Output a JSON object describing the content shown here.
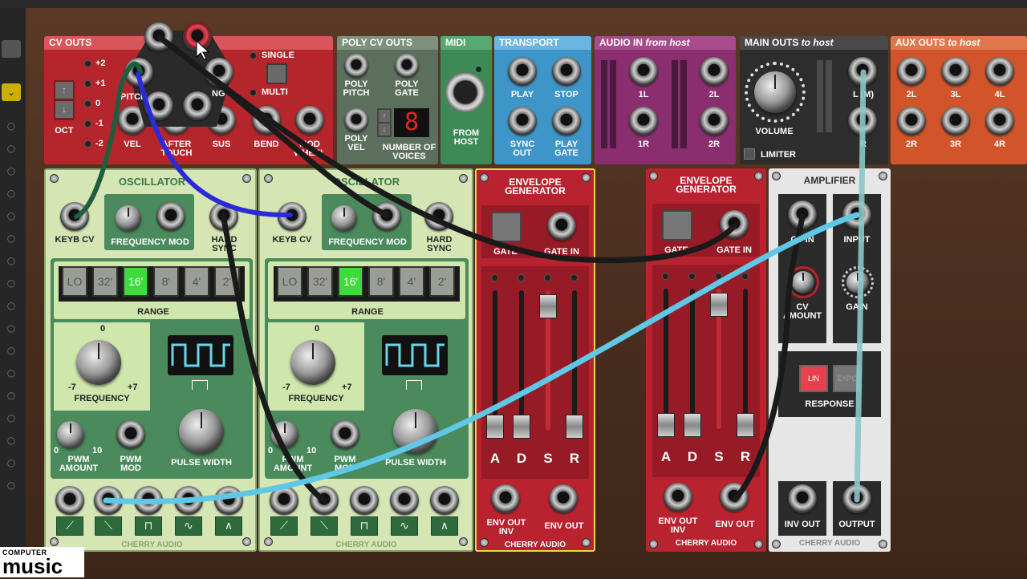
{
  "cv_outs": {
    "title": "CV OUTS",
    "octaves": [
      "+2",
      "+1",
      "0",
      "-1",
      "-2"
    ],
    "oct_label": "OCT",
    "mode_single": "SINGLE",
    "mode_multi": "MULTI",
    "jack_labels": [
      "PITCH",
      "VEL",
      "AFTER TOUCH",
      "SUS",
      "BEND",
      "MOD WHEEL",
      "NG"
    ]
  },
  "poly_cv_outs": {
    "title": "POLY CV OUTS",
    "poly_pitch": "POLY PITCH",
    "poly_gate": "POLY GATE",
    "poly_vel": "POLY VEL",
    "voices_label": "NUMBER OF VOICES",
    "voices_value": "8"
  },
  "midi": {
    "title": "MIDI",
    "from_host": "FROM HOST"
  },
  "transport": {
    "title": "TRANSPORT",
    "play": "PLAY",
    "stop": "STOP",
    "sync_out": "SYNC OUT",
    "play_gate": "PLAY GATE"
  },
  "audio_in": {
    "title": "AUDIO IN",
    "title_suffix": "from host",
    "l1": "1L",
    "r1": "1R",
    "l2": "2L",
    "r2": "2R"
  },
  "main_outs": {
    "title": "MAIN OUTS",
    "title_suffix": "to host",
    "volume": "VOLUME",
    "limiter": "LIMITER",
    "out_l": "L (M)",
    "out_r": "R"
  },
  "aux_outs": {
    "title": "AUX OUTS",
    "title_suffix": "to host",
    "labels": [
      "2L",
      "3L",
      "4L",
      "2R",
      "3R",
      "4R"
    ]
  },
  "oscillators": [
    {
      "title": "OSCILLATOR",
      "keyb_cv": "KEYB CV",
      "freq_mod": "FREQUENCY MOD",
      "hard_sync": "HARD SYNC",
      "range_options": [
        "LO",
        "32'",
        "16'",
        "8'",
        "4'",
        "2'"
      ],
      "range_selected": "16'",
      "range_label": "RANGE",
      "freq_zero": "0",
      "freq_min": "-7",
      "freq_max": "+7",
      "frequency_label": "FREQUENCY",
      "pwm_min": "0",
      "pwm_max": "10",
      "pwm_amount": "PWM AMOUNT",
      "pwm_mod": "PWM MOD",
      "pulse_width": "PULSE WIDTH",
      "brand": "CHERRY AUDIO"
    },
    {
      "title": "OSCILLATOR",
      "keyb_cv": "KEYB CV",
      "freq_mod": "FREQUENCY MOD",
      "hard_sync": "HARD SYNC",
      "range_options": [
        "LO",
        "32'",
        "16'",
        "8'",
        "4'",
        "2'"
      ],
      "range_selected": "16'",
      "range_label": "RANGE",
      "freq_zero": "0",
      "freq_min": "-7",
      "freq_max": "+7",
      "frequency_label": "FREQUENCY",
      "pwm_min": "0",
      "pwm_max": "10",
      "pwm_amount": "PWM AMOUNT",
      "pwm_mod": "PWM MOD",
      "pulse_width": "PULSE WIDTH",
      "brand": "CHERRY AUDIO"
    }
  ],
  "envelopes": [
    {
      "title": "ENVELOPE GENERATOR",
      "gate": "GATE",
      "gate_in": "GATE IN",
      "adsr": [
        "A",
        "D",
        "S",
        "R"
      ],
      "env_out_inv": "ENV OUT INV",
      "env_out": "ENV OUT",
      "brand": "CHERRY AUDIO"
    },
    {
      "title": "ENVELOPE GENERATOR",
      "gate": "GATE",
      "gate_in": "GATE IN",
      "adsr": [
        "A",
        "D",
        "S",
        "R"
      ],
      "env_out_inv": "ENV OUT INV",
      "env_out": "ENV OUT",
      "brand": "CHERRY AUDIO"
    }
  ],
  "amplifier": {
    "title": "AMPLIFIER",
    "cv_in": "CV IN",
    "input": "INPUT",
    "cv_amount": "CV AMOUNT",
    "gain": "GAIN",
    "lin": "LIN",
    "expo": "EXPO",
    "response": "RESPONSE",
    "inv_out": "INV OUT",
    "output": "OUTPUT",
    "brand": "CHERRY AUDIO"
  },
  "watermark": {
    "line1": "COMPUTER",
    "line2": "music"
  },
  "colors": {
    "cable_blue": "#2a2ad8",
    "cable_cyan": "#5ec8e6",
    "cable_black": "#1a1a1a",
    "cable_green": "#1e5e3c"
  }
}
